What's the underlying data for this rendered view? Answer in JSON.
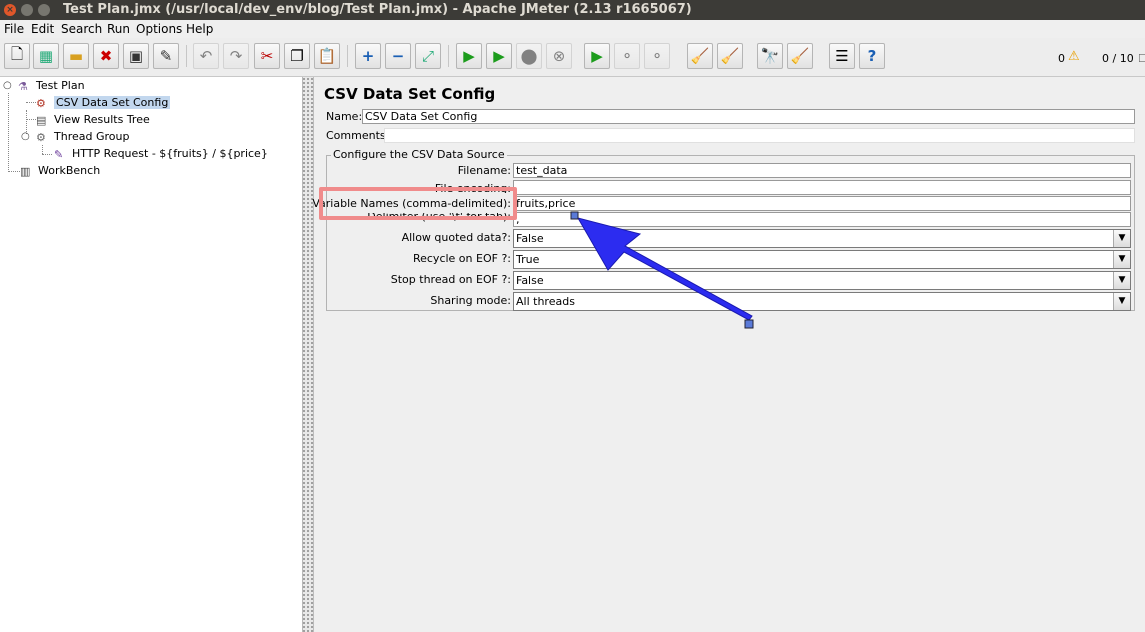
{
  "window": {
    "title": "Test Plan.jmx (/usr/local/dev_env/blog/Test Plan.jmx) - Apache JMeter (2.13 r1665067)"
  },
  "menu": [
    {
      "label": "File"
    },
    {
      "label": "Edit"
    },
    {
      "label": "Search"
    },
    {
      "label": "Run"
    },
    {
      "label": "Options"
    },
    {
      "label": "Help"
    }
  ],
  "toolbar": {
    "warning_count": "0",
    "thread_count": "0 / 10"
  },
  "tree": {
    "items": [
      {
        "label": "Test Plan",
        "icon": "flask-icon"
      },
      {
        "label": "CSV Data Set Config",
        "icon": "csv-config-icon"
      },
      {
        "label": "View Results Tree",
        "icon": "results-tree-icon"
      },
      {
        "label": "Thread Group",
        "icon": "thread-group-icon"
      },
      {
        "label": "HTTP Request - ${fruits} / ${price}",
        "icon": "http-request-icon"
      },
      {
        "label": "WorkBench",
        "icon": "workbench-icon"
      }
    ]
  },
  "panel": {
    "title": "CSV Data Set Config",
    "name_label": "Name:",
    "name_value": "CSV Data Set Config",
    "comments_label": "Comments:",
    "group_title": "Configure the CSV Data Source",
    "fields": [
      {
        "label": "Filename:",
        "value": "test_data"
      },
      {
        "label": "File encoding:",
        "value": ""
      },
      {
        "label": "Variable Names (comma-delimited):",
        "value": "fruits,price"
      },
      {
        "label": "Delimiter (use '\\t' for tab):",
        "value": ","
      }
    ],
    "selects": [
      {
        "label": "Allow quoted data?:",
        "value": "False"
      },
      {
        "label": "Recycle on EOF ?:",
        "value": "True"
      },
      {
        "label": "Stop thread on EOF ?:",
        "value": "False"
      },
      {
        "label": "Sharing mode:",
        "value": "All threads"
      }
    ]
  },
  "colors": {
    "highlight": "#f08b8b",
    "arrow": "#2c2cf0",
    "selection": "#c2d7ee"
  }
}
